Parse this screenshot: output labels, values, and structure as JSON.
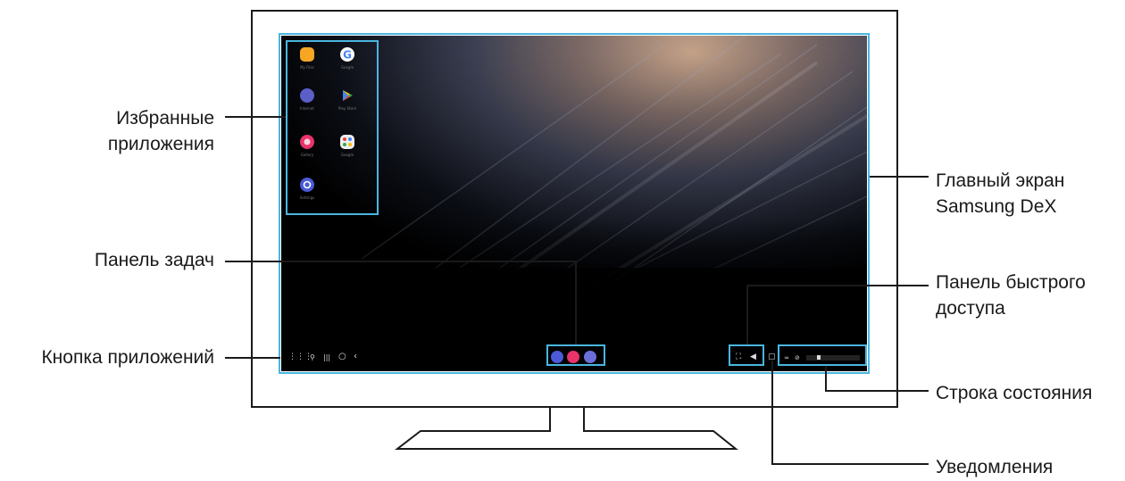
{
  "labels": {
    "favorites": [
      "Избранные",
      "приложения"
    ],
    "main_screen": [
      "Главный экран",
      "Samsung DeX"
    ],
    "taskbar": "Панель задач",
    "quick_access": [
      "Панель быстрого",
      "доступа"
    ],
    "apps_button": "Кнопка приложений",
    "status_bar": "Строка состояния",
    "notifications": "Уведомления"
  },
  "favorite_apps": [
    {
      "icon": "folder-icon",
      "color": "#f6a623"
    },
    {
      "icon": "google-icon",
      "color": "#ffffff"
    },
    {
      "icon": "internet-icon",
      "color": "#5b5fc7"
    },
    {
      "icon": "play-store-icon",
      "color": "#ffffff"
    },
    {
      "icon": "gallery-icon",
      "color": "#e8336b"
    },
    {
      "icon": "google-apps-folder-icon",
      "color": "#ffffff"
    },
    {
      "icon": "settings-icon",
      "color": "#4a5ad8"
    }
  ],
  "colors": {
    "highlight": "#4ab6e0",
    "line": "#1a1a1a",
    "screen_bg": "#000000"
  }
}
